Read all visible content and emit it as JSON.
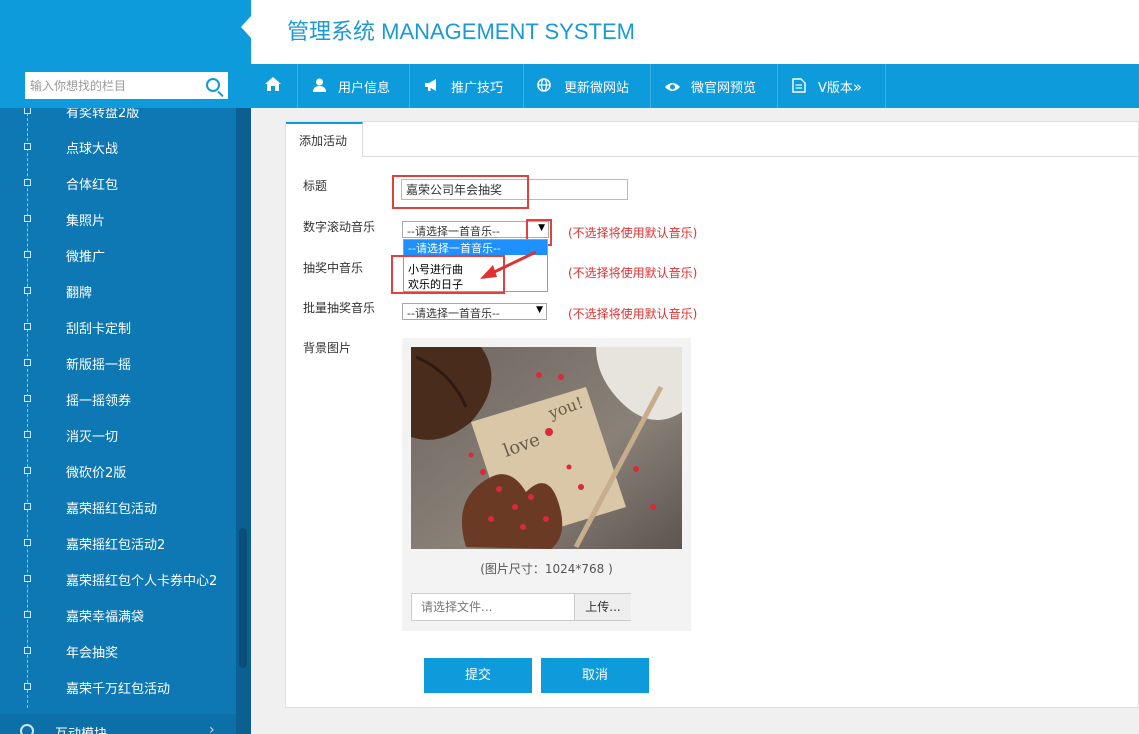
{
  "header": {
    "title": "管理系统 MANAGEMENT SYSTEM"
  },
  "search": {
    "placeholder": "输入你想找的栏目"
  },
  "nav": [
    {
      "label": "",
      "icon": "home-icon"
    },
    {
      "label": "用户信息",
      "icon": "user-icon"
    },
    {
      "label": "推广技巧",
      "icon": "megaphone-icon"
    },
    {
      "label": "更新微网站",
      "icon": "globe-icon"
    },
    {
      "label": "微官网预览",
      "icon": "eye-icon"
    },
    {
      "label": "V版本",
      "icon": "document-icon",
      "suffix": "»"
    }
  ],
  "sidebar": {
    "items": [
      {
        "label": "有奖转盘2版"
      },
      {
        "label": "点球大战"
      },
      {
        "label": "合体红包"
      },
      {
        "label": "集照片"
      },
      {
        "label": "微推广"
      },
      {
        "label": "翻牌"
      },
      {
        "label": "刮刮卡定制"
      },
      {
        "label": "新版摇一摇"
      },
      {
        "label": "摇一摇领券"
      },
      {
        "label": "消灭一切"
      },
      {
        "label": "微砍价2版"
      },
      {
        "label": "嘉荣摇红包活动"
      },
      {
        "label": "嘉荣摇红包活动2"
      },
      {
        "label": "嘉荣摇红包个人卡券中心2"
      },
      {
        "label": "嘉荣幸福满袋"
      },
      {
        "label": "年会抽奖"
      },
      {
        "label": "嘉荣千万红包活动"
      }
    ],
    "module": {
      "label": "互动模块",
      "arrow": "›"
    }
  },
  "tabs": [
    {
      "label": "添加活动"
    }
  ],
  "form": {
    "title_label": "标题",
    "title_value": "嘉荣公司年会抽奖",
    "music1_label": "数字滚动音乐",
    "music2_label": "抽奖中音乐",
    "music3_label": "批量抽奖音乐",
    "select_default": "--请选择一首音乐--",
    "arrow": "▼",
    "hint": "(不选择将使用默认音乐)",
    "dropdown_options": [
      "--请选择一首音乐--",
      "小号进行曲",
      "欢乐的日子"
    ],
    "bg_label": "背景图片",
    "img_size": "(图片尺寸：1024*768 )",
    "file_placeholder": "请选择文件...",
    "upload_label": "上传...",
    "submit_label": "提交",
    "cancel_label": "取消"
  },
  "colors": {
    "accent": "#0e9bdc",
    "sidebar": "#0e78b4",
    "hint": "#e03030",
    "title": "#1a9ad6"
  }
}
